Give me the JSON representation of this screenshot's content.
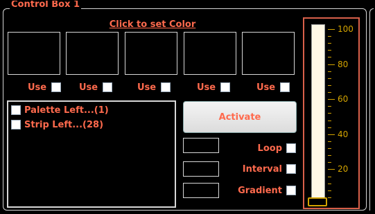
{
  "frame": {
    "title": "Control Box 1"
  },
  "color_link": "Click to set Color",
  "swatches": [
    {
      "use_label": "Use"
    },
    {
      "use_label": "Use"
    },
    {
      "use_label": "Use"
    },
    {
      "use_label": "Use"
    },
    {
      "use_label": "Use"
    }
  ],
  "list": {
    "items": [
      "Palette Left...(1)",
      "Strip Left...(28)"
    ]
  },
  "activate_label": "Activate",
  "options": {
    "loop": "Loop",
    "interval": "Interval",
    "gradient": "Gradient"
  },
  "slider": {
    "ticks": [
      "100",
      "80",
      "60",
      "40",
      "20"
    ],
    "value": 0,
    "min": 0,
    "max": 100
  },
  "colors": {
    "accent": "#ff6a4d",
    "tick": "#d4a400",
    "border": "#d8d8d8"
  }
}
